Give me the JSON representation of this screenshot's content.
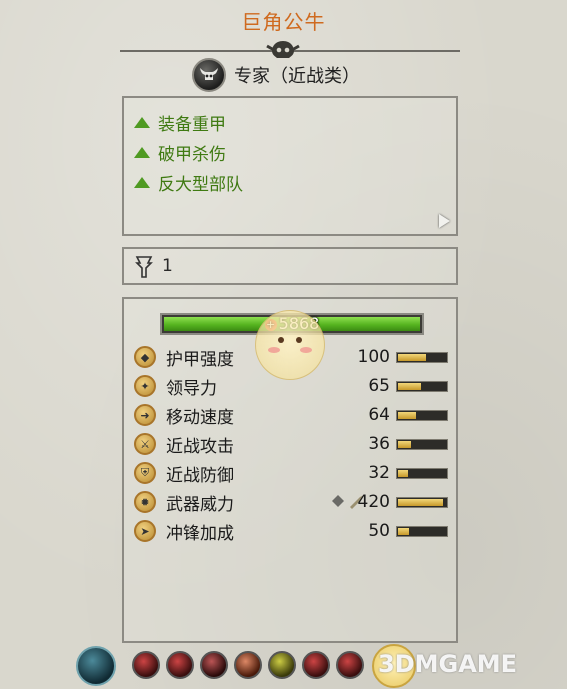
{
  "unit": {
    "name": "巨角公牛"
  },
  "category": {
    "label": "专家（近战类）",
    "icon": "horned-skull-icon"
  },
  "traits": [
    {
      "label": "装备重甲"
    },
    {
      "label": "破甲杀伤"
    },
    {
      "label": "反大型部队"
    }
  ],
  "rank": {
    "value": "1",
    "icon": "rank-chevron-icon"
  },
  "health": {
    "value": "5868",
    "fraction": 1.0
  },
  "stats": [
    {
      "label": "护甲强度",
      "value": "100",
      "fraction": 0.55,
      "icon": "armour-icon"
    },
    {
      "label": "领导力",
      "value": "65",
      "fraction": 0.45,
      "icon": "leadership-icon"
    },
    {
      "label": "移动速度",
      "value": "64",
      "fraction": 0.35,
      "icon": "speed-icon"
    },
    {
      "label": "近战攻击",
      "value": "36",
      "fraction": 0.25,
      "icon": "melee-attack-icon"
    },
    {
      "label": "近战防御",
      "value": "32",
      "fraction": 0.2,
      "icon": "melee-defence-icon"
    },
    {
      "label": "武器威力",
      "value": "420",
      "fraction": 0.9,
      "icon": "weapon-strength-icon"
    },
    {
      "label": "冲锋加成",
      "value": "50",
      "fraction": 0.22,
      "icon": "charge-bonus-icon"
    }
  ],
  "watermark": {
    "text": "3DMGAME"
  },
  "colors": {
    "title": "#cf6a1f",
    "trait": "#3f7a12",
    "health": "#56b420"
  }
}
